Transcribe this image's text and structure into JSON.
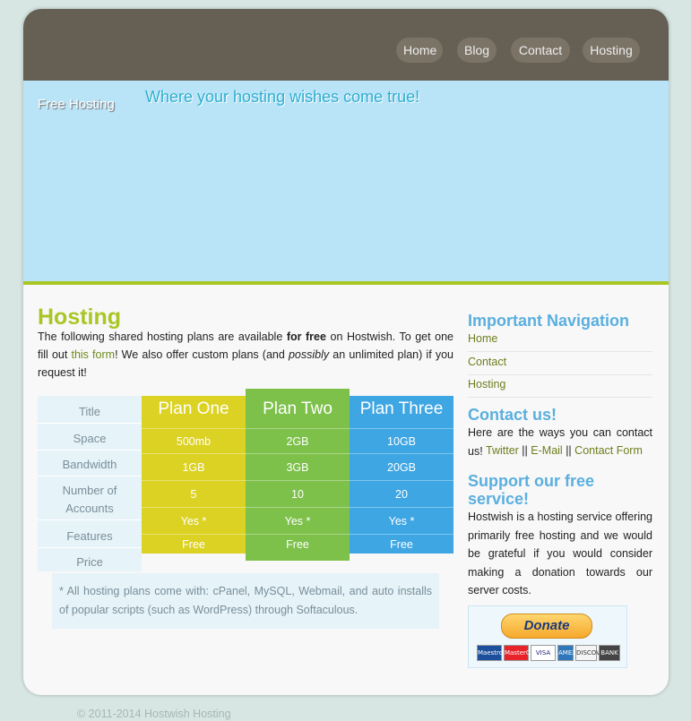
{
  "nav": {
    "items": [
      {
        "label": "Home"
      },
      {
        "label": "Blog"
      },
      {
        "label": "Contact"
      },
      {
        "label": "Hosting"
      }
    ]
  },
  "banner": {
    "logo_text": "Free Hosting",
    "tagline": "Where your hosting wishes come true!"
  },
  "main": {
    "title": "Hosting",
    "intro_part1": "The following shared hosting plans are available ",
    "intro_bold": "for free",
    "intro_part2": " on Hostwish. To get one fill out ",
    "intro_link": "this form",
    "intro_part3": "! We also offer custom plans (and ",
    "intro_italic": "possibly",
    "intro_part4": " an unlimited plan) if you request it!",
    "table": {
      "row_labels": [
        "Title",
        "Space",
        "Bandwidth",
        "Number of Accounts",
        "Features",
        "Price"
      ],
      "plans": [
        {
          "title": "Plan One",
          "space": "500mb",
          "bandwidth": "1GB",
          "accounts": "5",
          "features": "Yes *",
          "price": "Free",
          "color": "#dcd223"
        },
        {
          "title": "Plan Two",
          "space": "2GB",
          "bandwidth": "3GB",
          "accounts": "10",
          "features": "Yes *",
          "price": "Free",
          "color": "#7dc04a"
        },
        {
          "title": "Plan Three",
          "space": "10GB",
          "bandwidth": "20GB",
          "accounts": "20",
          "features": "Yes *",
          "price": "Free",
          "color": "#3ea6e3"
        }
      ]
    },
    "note": "* All hosting plans come with: cPanel, MySQL, Webmail, and auto installs of popular scripts (such as WordPress) through Softaculous."
  },
  "sidebar": {
    "nav_title": "Important Navigation",
    "nav_links": [
      "Home",
      "Contact",
      "Hosting"
    ],
    "contact_title": "Contact us!",
    "contact_text": "Here are the ways you can contact us!",
    "contact_links": [
      "Twitter",
      "E-Mail",
      "Contact Form"
    ],
    "contact_sep": "||",
    "support_title": "Support our free service!",
    "support_text": "Hostwish is a hosting service offering primarily free hosting and we would be grateful if you would consider making a donation towards our server costs.",
    "donate_label": "Donate",
    "cards": [
      "Maestro",
      "MasterCard",
      "VISA",
      "AMEX",
      "DISCOVER",
      "BANK"
    ]
  },
  "footer": {
    "text": "© 2011-2014 Hostwish Hosting"
  }
}
